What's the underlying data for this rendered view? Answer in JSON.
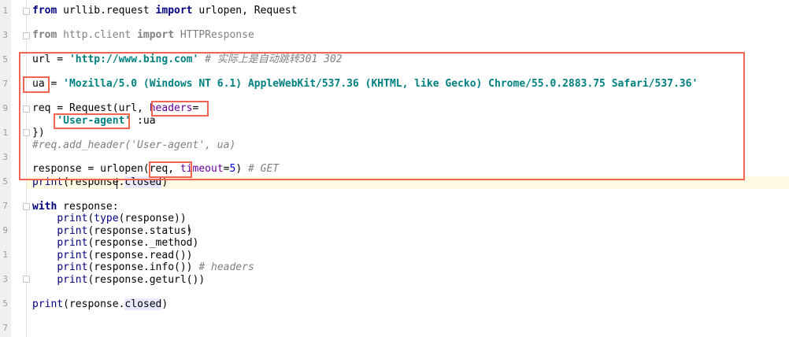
{
  "editor": {
    "line_numbers": [
      "1",
      "",
      "3",
      "",
      "5",
      "",
      "7",
      "",
      "9",
      "",
      "1",
      "",
      "3",
      "",
      "5",
      "",
      "7",
      "",
      "9",
      "",
      "1",
      "",
      "3",
      "",
      "5",
      "",
      "7",
      ""
    ],
    "lines": [
      [
        [
          "kw",
          "from"
        ],
        [
          "",
          "  urllib.request "
        ],
        [
          "kw",
          "import"
        ],
        [
          "",
          "",
          " urlopen, Request"
        ]
      ],
      []
    ]
  },
  "code": {
    "l1a": "from",
    "l1b": " urllib.request ",
    "l1c": "import",
    "l1d": " urlopen, Request",
    "l3a": "from",
    "l3b": " http.client ",
    "l3c": "import",
    "l3d": " HTTPResponse",
    "l5a": "url = ",
    "l5b": "'http://www.bing.com'",
    "l5c": " # 实际上是自动跳转301 302",
    "l7a": "ua",
    "l7b": " = ",
    "l7c": "'Mozilla/5.0 (Windows NT 6.1) AppleWebKit/537.36 (KHTML, like Gecko) Chrome/55.0.2883.75 Safari/537.36'",
    "l9a": "req = Request(url, ",
    "l9b": "headers",
    "l9c": "=",
    "l10a": "    ",
    "l10b": "'User-agent'",
    "l10c": " :ua",
    "l11a": "})",
    "l12a": "#req.add_header('User-agent', ua)",
    "l14a": "response = urlopen(",
    "l14b": "req, ",
    "l14c": "timeout",
    "l14d": "=",
    "l14e": "5",
    "l14f": ")",
    "l14g": " # GET",
    "l15a": "print",
    "l15b": "(response.",
    "l15c": "closed",
    "l15d": ")",
    "l17a": "with",
    "l17b": " response:",
    "l18a": "    ",
    "l18b": "print",
    "l18c": "(",
    "l18d": "type",
    "l18e": "(response))",
    "l19a": "    ",
    "l19b": "print",
    "l19c": "(response.status)",
    "l20a": "    ",
    "l20b": "print",
    "l20c": "(response._method)",
    "l21a": "    ",
    "l21b": "print",
    "l21c": "(response.read())",
    "l22a": "    ",
    "l22b": "print",
    "l22c": "(response.info())",
    "l22d": " # headers",
    "l23a": "    ",
    "l23b": "print",
    "l23c": "(response.geturl())",
    "l25a": "print",
    "l25b": "(response.",
    "l25c": "closed",
    "l25d": ")"
  },
  "colors": {
    "highlight_box": "#f26452",
    "keyword": "#000080",
    "string": "#008080",
    "comment": "#808080"
  }
}
